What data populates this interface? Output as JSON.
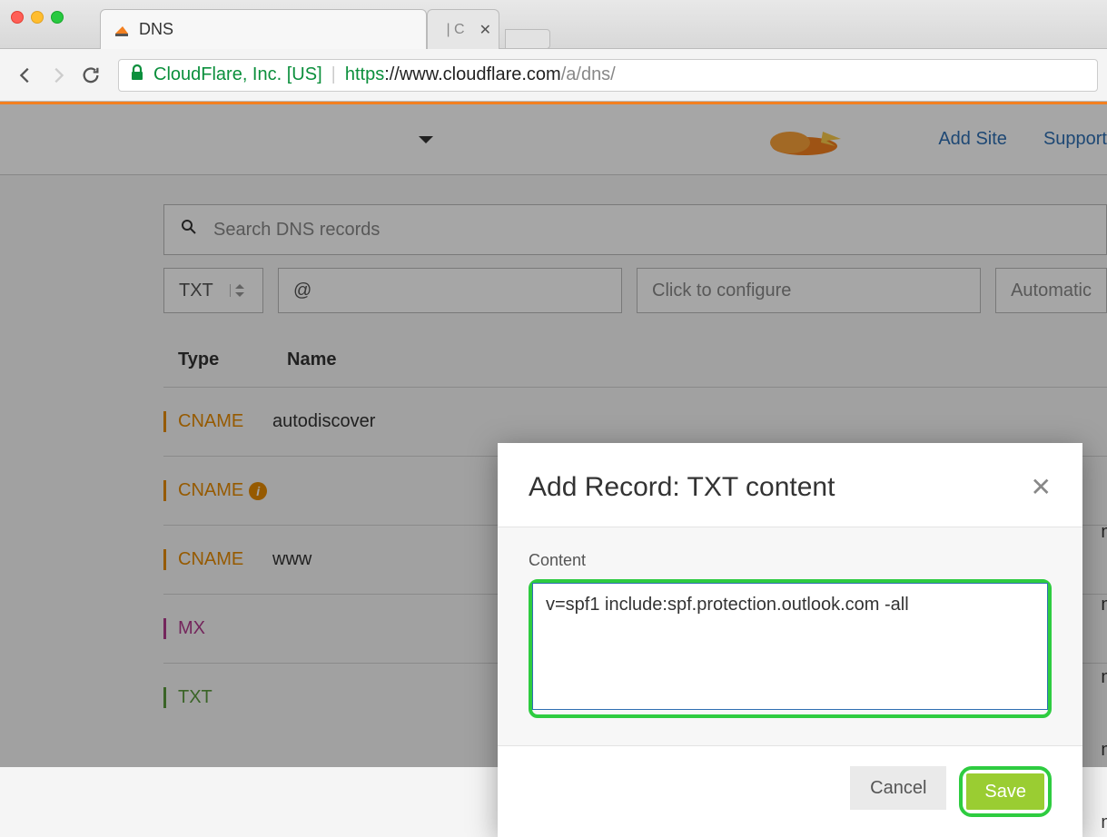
{
  "browser": {
    "tab_title": "DNS",
    "partial_tab_hint": "| C",
    "org_name": "CloudFlare, Inc. [US]",
    "url_scheme": "https",
    "url_colon": "://",
    "url_host": "www.cloudflare.com",
    "url_path": "/a/dns/"
  },
  "header": {
    "nav_add_site": "Add Site",
    "nav_support": "Support"
  },
  "search": {
    "placeholder": "Search DNS records"
  },
  "add_record_bar": {
    "type_selected": "TXT",
    "name_value": "@",
    "configure_placeholder": "Click to configure",
    "ttl_placeholder": "Automatic"
  },
  "table": {
    "col_type": "Type",
    "col_name": "Name",
    "rows": [
      {
        "type": "CNAME",
        "type_class": "type-cname",
        "name": "autodiscover",
        "info": false
      },
      {
        "type": "CNAME",
        "type_class": "type-cname",
        "name": "",
        "info": true
      },
      {
        "type": "CNAME",
        "type_class": "type-cname",
        "name": "www",
        "info": false
      },
      {
        "type": "MX",
        "type_class": "type-mx",
        "name": "",
        "info": false
      },
      {
        "type": "TXT",
        "type_class": "type-txt",
        "name": "",
        "info": false
      }
    ]
  },
  "modal": {
    "title": "Add Record: TXT content",
    "field_label": "Content",
    "content_value": "v=spf1 include:spf.protection.outlook.com -all",
    "cancel_label": "Cancel",
    "save_label": "Save"
  }
}
